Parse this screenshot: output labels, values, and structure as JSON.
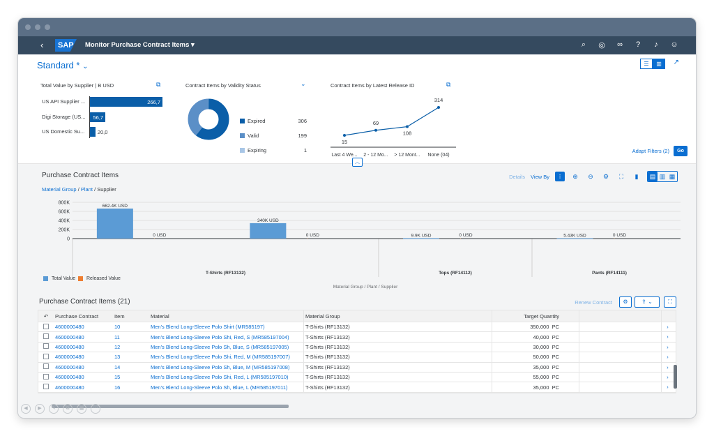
{
  "shell": {
    "back_icon": "back-arrow-icon",
    "logo": "SAP",
    "app_title": "Monitor Purchase Contract Items",
    "app_title_chevron": "▾",
    "icons": [
      "search-icon",
      "copilot-icon",
      "binoculars-icon",
      "help-icon",
      "bell-icon",
      "user-icon"
    ]
  },
  "header": {
    "variant": "Standard *",
    "variant_chevron": "⌄",
    "adapt_filters": "Adapt Filters (2)",
    "go": "Go"
  },
  "kpi1": {
    "title": "Total Value by Supplier | B USD",
    "bars": [
      {
        "label": "US API Supplier ...",
        "value": 266.7,
        "text": "266,7"
      },
      {
        "label": "Digi Storage (US...",
        "value": 56.7,
        "text": "56,7"
      },
      {
        "label": "US Domestic Su...",
        "value": 20.0,
        "text": "20,0"
      }
    ]
  },
  "kpi2": {
    "title": "Contract Items by Validity Status",
    "legend": [
      {
        "label": "Expired",
        "value": "306",
        "color": "#0a5ea8"
      },
      {
        "label": "Valid",
        "value": "199",
        "color": "#5b8fc7"
      },
      {
        "label": "Expiring",
        "value": "1",
        "color": "#a8c6e6"
      }
    ]
  },
  "kpi3": {
    "title": "Contract Items by Latest Release ID",
    "points": [
      {
        "label": "Last 4 We...",
        "value": 15
      },
      {
        "label": "2 - 12 Mo...",
        "value": 69
      },
      {
        "label": "> 12 Mont...",
        "value": 108
      },
      {
        "label": "None (04)",
        "value": 314
      }
    ]
  },
  "panel": {
    "title": "Purchase Contract Items",
    "breadcrumb_1": "Material Group",
    "breadcrumb_sep": " / ",
    "breadcrumb_2": "Plant",
    "breadcrumb_3": "Supplier",
    "details": "Details",
    "view_by": "View By"
  },
  "chart_data": {
    "type": "bar",
    "title": "",
    "xlabel": "Material Group / Plant / Supplier",
    "ylabel": "",
    "yticks": [
      "800K",
      "600K",
      "400K",
      "200K",
      "0"
    ],
    "ylim": [
      0,
      800000
    ],
    "series": [
      {
        "name": "Total Value",
        "color": "#5b9bd5"
      },
      {
        "name": "Released Value",
        "color": "#ed7d31"
      }
    ],
    "groups": [
      {
        "label": "T-Shirts (RF13132)",
        "pairs": [
          {
            "total": 662400,
            "total_text": "662.4K USD",
            "released": 0,
            "released_text": "0 USD"
          },
          {
            "total": 340000,
            "total_text": "340K USD",
            "released": 0,
            "released_text": "0 USD"
          }
        ]
      },
      {
        "label": "Tops (RF14112)",
        "pairs": [
          {
            "total": 9900,
            "total_text": "9.9K USD",
            "released": 0,
            "released_text": "0 USD"
          }
        ]
      },
      {
        "label": "Pants (RF14111)",
        "pairs": [
          {
            "total": 5430,
            "total_text": "5.43K USD",
            "released": 0,
            "released_text": "0 USD"
          }
        ]
      }
    ]
  },
  "table": {
    "title": "Purchase Contract Items (21)",
    "renew": "Renew Contract",
    "columns": [
      "Purchase Contract",
      "Item",
      "Material",
      "Material Group",
      "Target Quantity"
    ],
    "rows": [
      {
        "contract": "4600000480",
        "item": "10",
        "material": "Men's Blend Long-Sleeve Polo Shirt (MR585197)",
        "group": "T-Shirts (RF13132)",
        "qty": "350,000",
        "unit": "PC"
      },
      {
        "contract": "4600000480",
        "item": "11",
        "material": "Men's Blend Long-Sleeve Polo Shi, Red, S (MR585197004)",
        "group": "T-Shirts (RF13132)",
        "qty": "40,000",
        "unit": "PC"
      },
      {
        "contract": "4600000480",
        "item": "12",
        "material": "Men's Blend Long-Sleeve Polo Sh, Blue, S (MR585197005)",
        "group": "T-Shirts (RF13132)",
        "qty": "30,000",
        "unit": "PC"
      },
      {
        "contract": "4600000480",
        "item": "13",
        "material": "Men's Blend Long-Sleeve Polo Shi, Red, M (MR585197007)",
        "group": "T-Shirts (RF13132)",
        "qty": "50,000",
        "unit": "PC"
      },
      {
        "contract": "4600000480",
        "item": "14",
        "material": "Men's Blend Long-Sleeve Polo Sh, Blue, M (MR585197008)",
        "group": "T-Shirts (RF13132)",
        "qty": "35,000",
        "unit": "PC"
      },
      {
        "contract": "4600000480",
        "item": "15",
        "material": "Men's Blend Long-Sleeve Polo Shi, Red, L (MR585197010)",
        "group": "T-Shirts (RF13132)",
        "qty": "55,000",
        "unit": "PC"
      },
      {
        "contract": "4600000480",
        "item": "16",
        "material": "Men's Blend Long-Sleeve Polo Sh, Blue, L (MR585197011)",
        "group": "T-Shirts (RF13132)",
        "qty": "35,000",
        "unit": "PC"
      }
    ]
  }
}
